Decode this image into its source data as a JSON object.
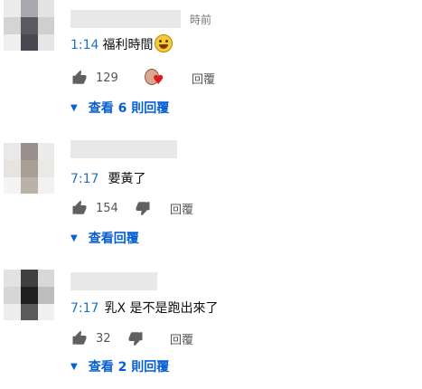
{
  "colors": {
    "link_blue": "#065fd4",
    "timestamp_blue": "#1f6fbf",
    "heart_red": "#e01b1b"
  },
  "comments": [
    {
      "author": "",
      "time": "時前",
      "timestamp": "1:14",
      "text": "福利時間",
      "emoji": "grinning-face-emoji",
      "likes": "129",
      "reply_label": "回覆",
      "view_replies": "查看 6 則回覆"
    },
    {
      "author": "",
      "time": "",
      "timestamp": "7:17",
      "text": "要黃了",
      "likes": "154",
      "reply_label": "回覆",
      "view_replies": "查看回覆"
    },
    {
      "author": "",
      "time": "",
      "timestamp": "7:17",
      "text": "乳X 是不是跑出來了",
      "likes": "32",
      "reply_label": "回覆",
      "view_replies": "查看 2 則回覆"
    }
  ],
  "icons": {
    "like": "thumbs-up-icon",
    "dislike": "thumbs-down-icon",
    "expand": "caret-down-icon",
    "creator_heart": "creator-heart-icon"
  }
}
